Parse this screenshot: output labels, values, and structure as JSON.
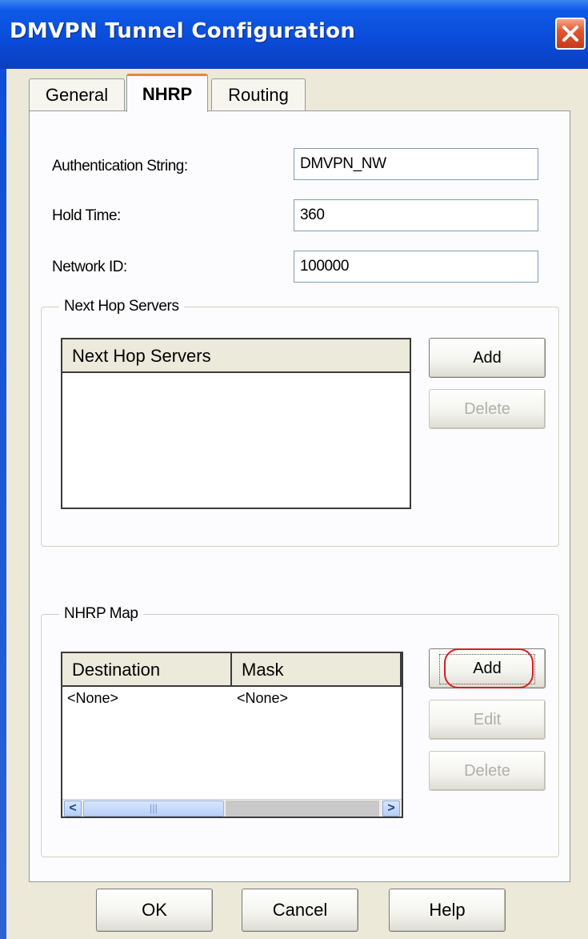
{
  "window": {
    "title": "DMVPN Tunnel Configuration"
  },
  "tabs": [
    {
      "label": "General"
    },
    {
      "label": "NHRP"
    },
    {
      "label": "Routing"
    }
  ],
  "active_tab": "NHRP",
  "fields": {
    "auth_string": {
      "label": "Authentication String:",
      "value": "DMVPN_NW"
    },
    "hold_time": {
      "label": "Hold Time:",
      "value": "360"
    },
    "network_id": {
      "label": "Network ID:",
      "value": "100000"
    }
  },
  "next_hop_servers": {
    "group_title": "Next Hop Servers",
    "column_header": "Next Hop Servers",
    "add_label": "Add",
    "delete_label": "Delete"
  },
  "nhrp_map": {
    "group_title": "NHRP Map",
    "columns": [
      "Destination",
      "Mask"
    ],
    "rows": [
      [
        "<None>",
        "<None>"
      ]
    ],
    "add_label": "Add",
    "edit_label": "Edit",
    "delete_label": "Delete",
    "scroll_left": "<",
    "scroll_right": ">",
    "scroll_thumb_grip": "|||"
  },
  "footer": {
    "ok_label": "OK",
    "cancel_label": "Cancel",
    "help_label": "Help"
  },
  "colors": {
    "title_bar": "#0a4bd8",
    "close_button": "#e2572f",
    "highlight": "#d32020",
    "active_tab_accent": "#e68b2c"
  }
}
